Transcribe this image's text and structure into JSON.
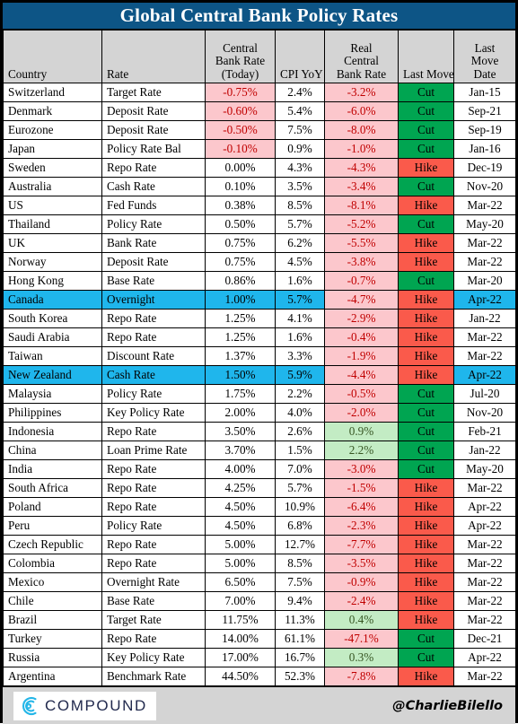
{
  "title": "Global Central Bank Policy Rates",
  "columns": [
    "Country",
    "Rate",
    "Central Bank Rate (Today)",
    "CPI YoY",
    "Real Central Bank Rate",
    "Last Move",
    "Last Move Date"
  ],
  "column_header_lines": {
    "country": [
      "Country"
    ],
    "rate": [
      "Rate"
    ],
    "cbr": [
      "Central",
      "Bank Rate",
      "(Today)"
    ],
    "cpi": [
      "CPI YoY"
    ],
    "real": [
      "Real",
      "Central",
      "Bank Rate"
    ],
    "move": [
      "Last Move"
    ],
    "date": [
      "Last",
      "Move",
      "Date"
    ]
  },
  "colors": {
    "title_bar": "#0d5586",
    "header_fill": "#d4d4d4",
    "negative_tint": "#fcc7cc",
    "negative_text": "#c00000",
    "positive_tint": "#c3ecc4",
    "positive_text": "#375623",
    "cut": "#00a551",
    "hike": "#fa5a4b",
    "highlight_row": "#1fb6ec",
    "border": "#000000"
  },
  "rows": [
    {
      "country": "Switzerland",
      "rate": "Target Rate",
      "cbr": "-0.75%",
      "cbr_sign": "neg",
      "cpi": "2.4%",
      "real": "-3.2%",
      "real_sign": "neg",
      "move": "Cut",
      "date": "Jan-15",
      "highlight": false
    },
    {
      "country": "Denmark",
      "rate": "Deposit Rate",
      "cbr": "-0.60%",
      "cbr_sign": "neg",
      "cpi": "5.4%",
      "real": "-6.0%",
      "real_sign": "neg",
      "move": "Cut",
      "date": "Sep-21",
      "highlight": false
    },
    {
      "country": "Eurozone",
      "rate": "Deposit Rate",
      "cbr": "-0.50%",
      "cbr_sign": "neg",
      "cpi": "7.5%",
      "real": "-8.0%",
      "real_sign": "neg",
      "move": "Cut",
      "date": "Sep-19",
      "highlight": false
    },
    {
      "country": "Japan",
      "rate": "Policy Rate Bal",
      "cbr": "-0.10%",
      "cbr_sign": "neg",
      "cpi": "0.9%",
      "real": "-1.0%",
      "real_sign": "neg",
      "move": "Cut",
      "date": "Jan-16",
      "highlight": false
    },
    {
      "country": "Sweden",
      "rate": "Repo Rate",
      "cbr": "0.00%",
      "cbr_sign": "plain",
      "cpi": "4.3%",
      "real": "-4.3%",
      "real_sign": "neg",
      "move": "Hike",
      "date": "Dec-19",
      "highlight": false
    },
    {
      "country": "Australia",
      "rate": "Cash Rate",
      "cbr": "0.10%",
      "cbr_sign": "plain",
      "cpi": "3.5%",
      "real": "-3.4%",
      "real_sign": "neg",
      "move": "Cut",
      "date": "Nov-20",
      "highlight": false
    },
    {
      "country": "US",
      "rate": "Fed Funds",
      "cbr": "0.38%",
      "cbr_sign": "plain",
      "cpi": "8.5%",
      "real": "-8.1%",
      "real_sign": "neg",
      "move": "Hike",
      "date": "Mar-22",
      "highlight": false
    },
    {
      "country": "Thailand",
      "rate": "Policy Rate",
      "cbr": "0.50%",
      "cbr_sign": "plain",
      "cpi": "5.7%",
      "real": "-5.2%",
      "real_sign": "neg",
      "move": "Cut",
      "date": "May-20",
      "highlight": false
    },
    {
      "country": "UK",
      "rate": "Bank Rate",
      "cbr": "0.75%",
      "cbr_sign": "plain",
      "cpi": "6.2%",
      "real": "-5.5%",
      "real_sign": "neg",
      "move": "Hike",
      "date": "Mar-22",
      "highlight": false
    },
    {
      "country": "Norway",
      "rate": "Deposit Rate",
      "cbr": "0.75%",
      "cbr_sign": "plain",
      "cpi": "4.5%",
      "real": "-3.8%",
      "real_sign": "neg",
      "move": "Hike",
      "date": "Mar-22",
      "highlight": false
    },
    {
      "country": "Hong Kong",
      "rate": "Base Rate",
      "cbr": "0.86%",
      "cbr_sign": "plain",
      "cpi": "1.6%",
      "real": "-0.7%",
      "real_sign": "neg",
      "move": "Cut",
      "date": "Mar-20",
      "highlight": false
    },
    {
      "country": "Canada",
      "rate": "Overnight",
      "cbr": "1.00%",
      "cbr_sign": "plain",
      "cpi": "5.7%",
      "real": "-4.7%",
      "real_sign": "neg",
      "move": "Hike",
      "date": "Apr-22",
      "highlight": true
    },
    {
      "country": "South Korea",
      "rate": "Repo Rate",
      "cbr": "1.25%",
      "cbr_sign": "plain",
      "cpi": "4.1%",
      "real": "-2.9%",
      "real_sign": "neg",
      "move": "Hike",
      "date": "Jan-22",
      "highlight": false
    },
    {
      "country": "Saudi Arabia",
      "rate": "Repo Rate",
      "cbr": "1.25%",
      "cbr_sign": "plain",
      "cpi": "1.6%",
      "real": "-0.4%",
      "real_sign": "neg",
      "move": "Hike",
      "date": "Mar-22",
      "highlight": false
    },
    {
      "country": "Taiwan",
      "rate": "Discount Rate",
      "cbr": "1.37%",
      "cbr_sign": "plain",
      "cpi": "3.3%",
      "real": "-1.9%",
      "real_sign": "neg",
      "move": "Hike",
      "date": "Mar-22",
      "highlight": false
    },
    {
      "country": "New Zealand",
      "rate": "Cash Rate",
      "cbr": "1.50%",
      "cbr_sign": "plain",
      "cpi": "5.9%",
      "real": "-4.4%",
      "real_sign": "neg",
      "move": "Hike",
      "date": "Apr-22",
      "highlight": true
    },
    {
      "country": "Malaysia",
      "rate": "Policy Rate",
      "cbr": "1.75%",
      "cbr_sign": "plain",
      "cpi": "2.2%",
      "real": "-0.5%",
      "real_sign": "neg",
      "move": "Cut",
      "date": "Jul-20",
      "highlight": false
    },
    {
      "country": "Philippines",
      "rate": "Key Policy Rate",
      "cbr": "2.00%",
      "cbr_sign": "plain",
      "cpi": "4.0%",
      "real": "-2.0%",
      "real_sign": "neg",
      "move": "Cut",
      "date": "Nov-20",
      "highlight": false
    },
    {
      "country": "Indonesia",
      "rate": "Repo Rate",
      "cbr": "3.50%",
      "cbr_sign": "plain",
      "cpi": "2.6%",
      "real": "0.9%",
      "real_sign": "pos",
      "move": "Cut",
      "date": "Feb-21",
      "highlight": false
    },
    {
      "country": "China",
      "rate": "Loan Prime Rate",
      "cbr": "3.70%",
      "cbr_sign": "plain",
      "cpi": "1.5%",
      "real": "2.2%",
      "real_sign": "pos",
      "move": "Cut",
      "date": "Jan-22",
      "highlight": false
    },
    {
      "country": "India",
      "rate": "Repo Rate",
      "cbr": "4.00%",
      "cbr_sign": "plain",
      "cpi": "7.0%",
      "real": "-3.0%",
      "real_sign": "neg",
      "move": "Cut",
      "date": "May-20",
      "highlight": false
    },
    {
      "country": "South Africa",
      "rate": "Repo Rate",
      "cbr": "4.25%",
      "cbr_sign": "plain",
      "cpi": "5.7%",
      "real": "-1.5%",
      "real_sign": "neg",
      "move": "Hike",
      "date": "Mar-22",
      "highlight": false
    },
    {
      "country": "Poland",
      "rate": "Repo Rate",
      "cbr": "4.50%",
      "cbr_sign": "plain",
      "cpi": "10.9%",
      "real": "-6.4%",
      "real_sign": "neg",
      "move": "Hike",
      "date": "Apr-22",
      "highlight": false
    },
    {
      "country": "Peru",
      "rate": "Policy Rate",
      "cbr": "4.50%",
      "cbr_sign": "plain",
      "cpi": "6.8%",
      "real": "-2.3%",
      "real_sign": "neg",
      "move": "Hike",
      "date": "Apr-22",
      "highlight": false
    },
    {
      "country": "Czech Republic",
      "rate": "Repo Rate",
      "cbr": "5.00%",
      "cbr_sign": "plain",
      "cpi": "12.7%",
      "real": "-7.7%",
      "real_sign": "neg",
      "move": "Hike",
      "date": "Mar-22",
      "highlight": false
    },
    {
      "country": "Colombia",
      "rate": "Repo Rate",
      "cbr": "5.00%",
      "cbr_sign": "plain",
      "cpi": "8.5%",
      "real": "-3.5%",
      "real_sign": "neg",
      "move": "Hike",
      "date": "Mar-22",
      "highlight": false
    },
    {
      "country": "Mexico",
      "rate": "Overnight Rate",
      "cbr": "6.50%",
      "cbr_sign": "plain",
      "cpi": "7.5%",
      "real": "-0.9%",
      "real_sign": "neg",
      "move": "Hike",
      "date": "Mar-22",
      "highlight": false
    },
    {
      "country": "Chile",
      "rate": "Base Rate",
      "cbr": "7.00%",
      "cbr_sign": "plain",
      "cpi": "9.4%",
      "real": "-2.4%",
      "real_sign": "neg",
      "move": "Hike",
      "date": "Mar-22",
      "highlight": false
    },
    {
      "country": "Brazil",
      "rate": "Target Rate",
      "cbr": "11.75%",
      "cbr_sign": "plain",
      "cpi": "11.3%",
      "real": "0.4%",
      "real_sign": "pos",
      "move": "Hike",
      "date": "Mar-22",
      "highlight": false
    },
    {
      "country": "Turkey",
      "rate": "Repo Rate",
      "cbr": "14.00%",
      "cbr_sign": "plain",
      "cpi": "61.1%",
      "real": "-47.1%",
      "real_sign": "neg",
      "move": "Cut",
      "date": "Dec-21",
      "highlight": false
    },
    {
      "country": "Russia",
      "rate": "Key Policy Rate",
      "cbr": "17.00%",
      "cbr_sign": "plain",
      "cpi": "16.7%",
      "real": "0.3%",
      "real_sign": "pos",
      "move": "Cut",
      "date": "Apr-22",
      "highlight": false
    },
    {
      "country": "Argentina",
      "rate": "Benchmark Rate",
      "cbr": "44.50%",
      "cbr_sign": "plain",
      "cpi": "52.3%",
      "real": "-7.8%",
      "real_sign": "neg",
      "move": "Hike",
      "date": "Mar-22",
      "highlight": false
    }
  ],
  "footer": {
    "brand_name": "COMPOUND",
    "handle": "@CharlieBilello"
  }
}
